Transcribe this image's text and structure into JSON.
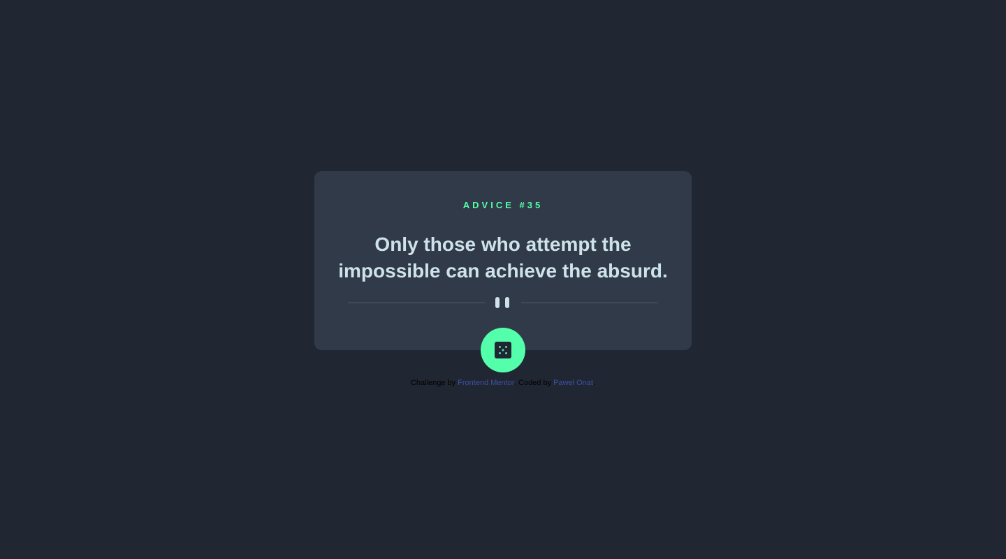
{
  "card": {
    "advice_label": "ADVICE #35",
    "quote": "Only those who attempt the impossible can achieve the absurd."
  },
  "dice_button": {
    "icon": "dice-icon"
  },
  "attribution": {
    "prefix": "Challenge by ",
    "link1": "Frontend Mentor",
    "middle": ". Coded by ",
    "link2": "Paweł Onat",
    "suffix": "."
  },
  "colors": {
    "background": "#202632",
    "card": "#313a48",
    "accent": "#53ffaa",
    "text": "#cee3e9",
    "divider": "#4f5d74",
    "link": "#3e52a3"
  }
}
